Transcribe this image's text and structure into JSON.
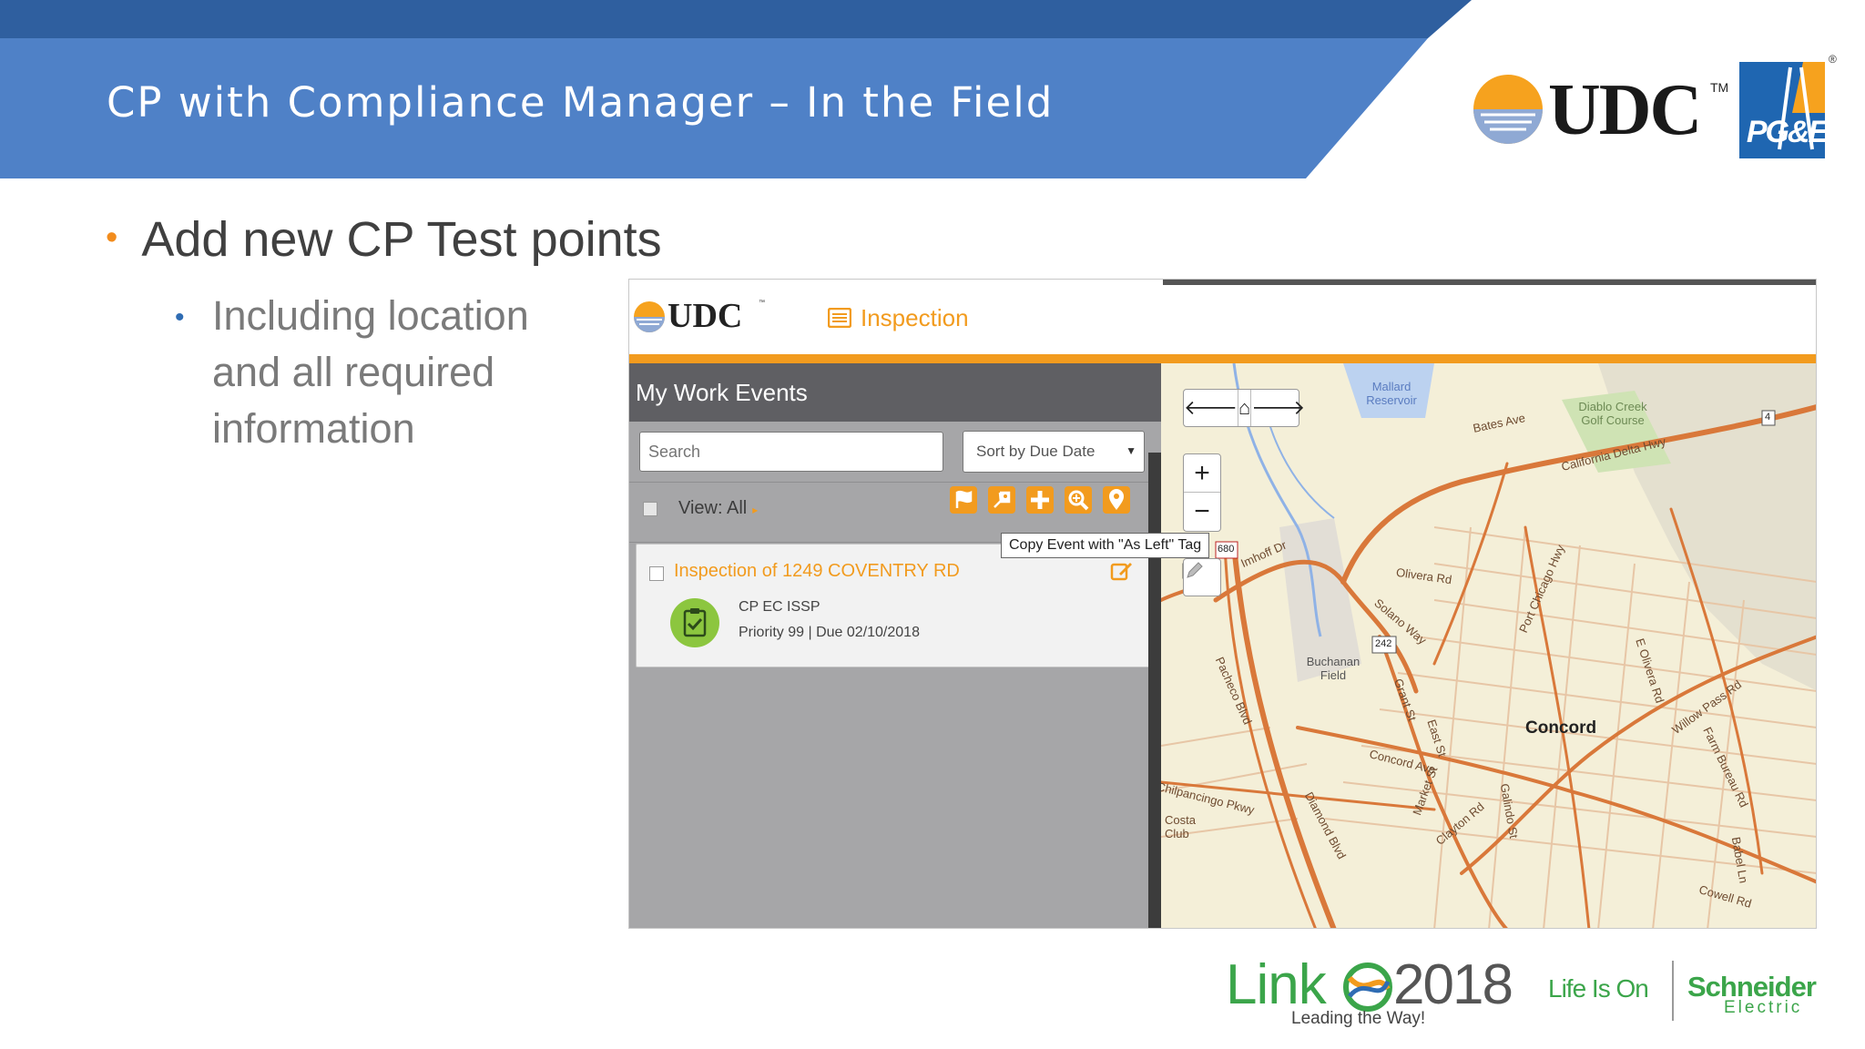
{
  "slide": {
    "title": "CP with Compliance Manager – In the Field",
    "bullet_main": "Add new CP Test points",
    "bullet_sub": "Including location and all required information"
  },
  "logos": {
    "udc_text": "UDC",
    "udc_tm": "TM",
    "pge_text": "PG&E",
    "pge_reg": "®",
    "link_text": "Link",
    "link_year": "2018",
    "link_tagline": "Leading the Way!",
    "life_is_on": "Life Is On",
    "schneider_line1": "Schneider",
    "schneider_line2": "Electric"
  },
  "app": {
    "logo_text": "UDC",
    "logo_tm": "™",
    "nav_label": "Inspection",
    "sidebar": {
      "title": "My Work Events",
      "search_placeholder": "Search",
      "sort_label": "Sort by Due Date",
      "view_label": "View: All",
      "toolbar_tooltip": "Copy Event with \"As Left\" Tag"
    },
    "event": {
      "title": "Inspection of 1249 COVENTRY RD",
      "type": "CP EC ISSP",
      "priority": "Priority 99",
      "separator": "|",
      "due": "Due 02/10/2018"
    },
    "map": {
      "labels": {
        "mallard": "Mallard Reservoir",
        "diablo": "Diablo Creek Golf Course",
        "bates": "Bates Ave",
        "california": "California Delta Hwy",
        "imhoff": "Imhoff Dr",
        "olivera": "Olivera Rd",
        "solano": "Solano Way",
        "port_chicago": "Port Chicago Hwy",
        "e_olivera": "E Olivera Rd",
        "willow": "Willow Pass Rd",
        "buchanan": "Buchanan Field",
        "pacheco": "Pacheco Blvd",
        "grant": "Grant St",
        "east": "East St",
        "concord": "Concord",
        "concord_ave": "Concord Ave",
        "farm_bureau": "Farm Bureau Rd",
        "chilpancingo": "Chilpancingo Pkwy",
        "costa": "Costa Club",
        "diamond": "Diamond Blvd",
        "market": "Market St",
        "clayton": "Clayton Rd",
        "galindo": "Galindo St",
        "babel": "Babel Ln",
        "cowell": "Cowell Rd",
        "route_4a": "4",
        "route_4b": "4",
        "route_680": "680",
        "route_242": "242"
      }
    }
  },
  "colors": {
    "header_blue": "#4f81c7",
    "header_dark": "#2f5f9f",
    "accent_orange": "#f29b1e",
    "sidebar_gray": "#a6a6a8",
    "sidebar_head": "#5f5f63",
    "road_orange": "#d9783a",
    "map_bg": "#f4efd8"
  }
}
